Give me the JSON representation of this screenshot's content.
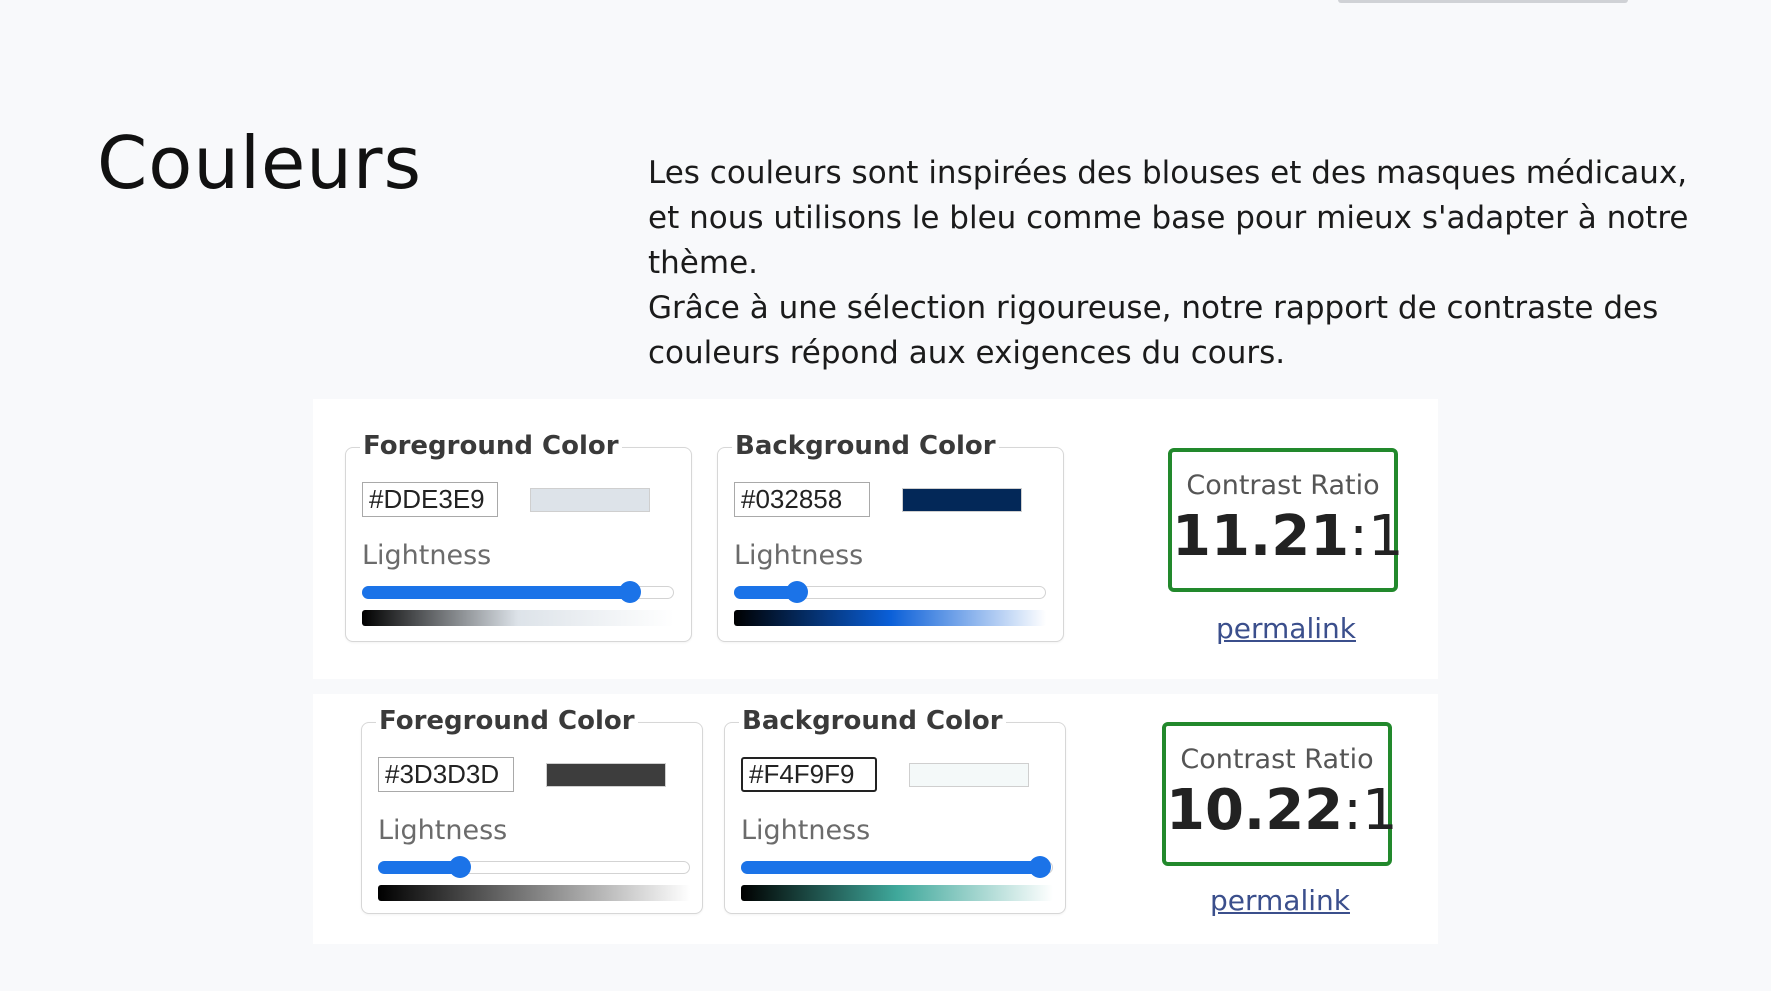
{
  "page": {
    "title": "Couleurs",
    "description": [
      "Les couleurs sont inspirées des blouses et des masques médicaux, et nous utilisons le bleu comme base pour mieux s'adapter à notre thème.",
      "Grâce à une sélection rigoureuse, notre rapport de contraste des couleurs répond aux exigences du cours."
    ]
  },
  "checkers": [
    {
      "foreground": {
        "legend": "Foreground Color",
        "hex": "#DDE3E9",
        "swatch_color": "#dde3e9",
        "lightness_label": "Lightness",
        "lightness_fraction": 0.86,
        "gradient": [
          "#000000",
          "#dde3e9",
          "#ffffff"
        ]
      },
      "background": {
        "legend": "Background Color",
        "hex": "#032858",
        "swatch_color": "#032858",
        "lightness_label": "Lightness",
        "lightness_fraction": 0.2,
        "gradient": [
          "#000000",
          "#0a5fd8",
          "#ffffff"
        ]
      },
      "result": {
        "label": "Contrast Ratio",
        "ratio": "11.21",
        "suffix": ":1",
        "border_color": "#22892c",
        "permalink": "permalink"
      }
    },
    {
      "foreground": {
        "legend": "Foreground Color",
        "hex": "#3D3D3D",
        "swatch_color": "#3d3d3d",
        "lightness_label": "Lightness",
        "lightness_fraction": 0.26,
        "gradient": [
          "#000000",
          "#808080",
          "#ffffff"
        ]
      },
      "background": {
        "legend": "Background Color",
        "hex": "#F4F9F9",
        "swatch_color": "#f4f9f9",
        "lightness_label": "Lightness",
        "lightness_fraction": 0.96,
        "gradient": [
          "#000000",
          "#3fa89b",
          "#ffffff"
        ]
      },
      "result": {
        "label": "Contrast Ratio",
        "ratio": "10.22",
        "suffix": ":1",
        "border_color": "#22892c",
        "permalink": "permalink"
      }
    }
  ],
  "colors": {
    "slider_accent": "#1b73e8",
    "pass_border": "#22892c",
    "link": "#3b4f8c"
  }
}
